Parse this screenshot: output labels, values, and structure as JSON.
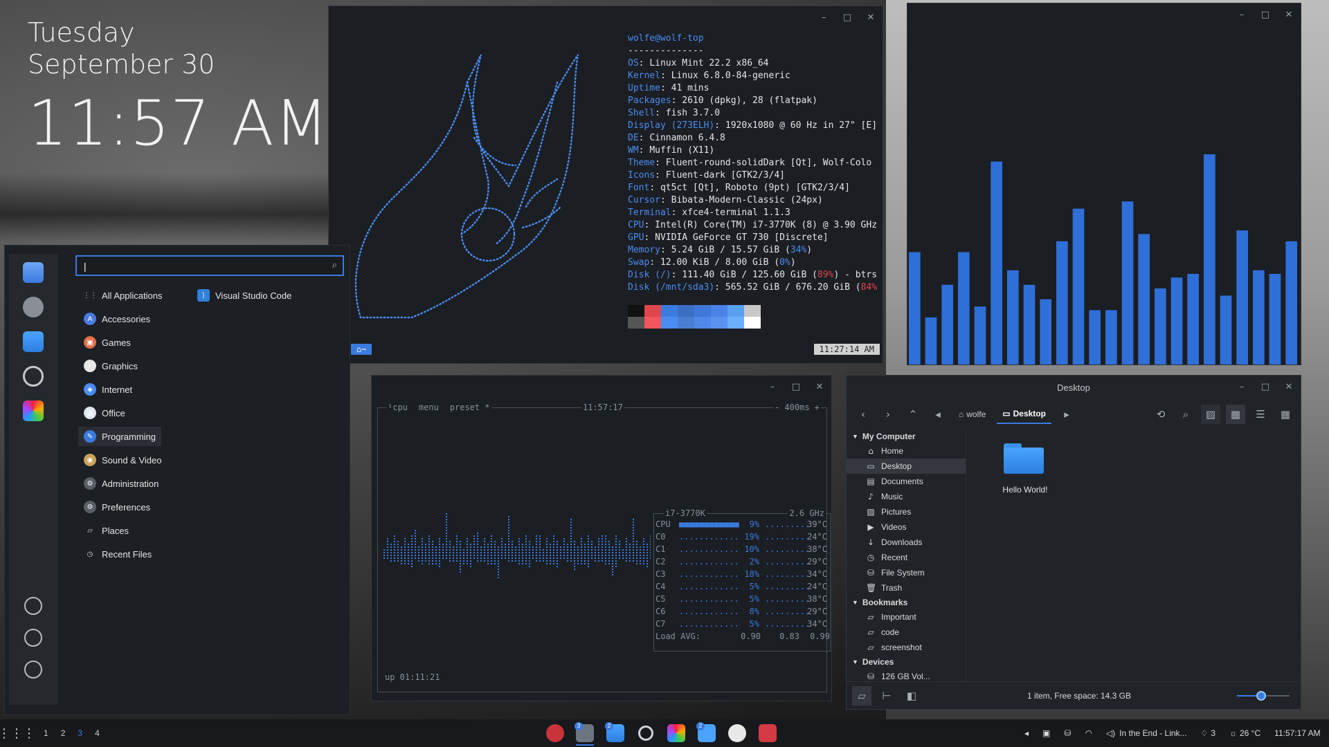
{
  "desklet": {
    "day": "Tuesday",
    "date": "September 30",
    "time": "11:57 AM"
  },
  "neofetch": {
    "user_host": "wolfe@wolf-top",
    "separator": "--------------",
    "lines": [
      {
        "k": "OS",
        "v": "Linux Mint 22.2 x86_64"
      },
      {
        "k": "Kernel",
        "v": "Linux 6.8.0-84-generic"
      },
      {
        "k": "Uptime",
        "v": "41 mins"
      },
      {
        "k": "Packages",
        "v": "2610 (dpkg), 28 (flatpak)"
      },
      {
        "k": "Shell",
        "v": "fish 3.7.0"
      },
      {
        "k": "Display (273ELH)",
        "v": "1920x1080 @ 60 Hz in 27\" [E]"
      },
      {
        "k": "DE",
        "v": "Cinnamon 6.4.8"
      },
      {
        "k": "WM",
        "v": "Muffin (X11)"
      },
      {
        "k": "Theme",
        "v": "Fluent-round-solidDark [Qt], Wolf-Colo"
      },
      {
        "k": "Icons",
        "v": "Fluent-dark [GTK2/3/4]"
      },
      {
        "k": "Font",
        "v": "qt5ct [Qt], Roboto (9pt) [GTK2/3/4]"
      },
      {
        "k": "Cursor",
        "v": "Bibata-Modern-Classic (24px)"
      },
      {
        "k": "Terminal",
        "v": "xfce4-terminal 1.1.3"
      },
      {
        "k": "CPU",
        "v": "Intel(R) Core(TM) i7-3770K (8) @ 3.90 GHz"
      },
      {
        "k": "GPU",
        "v": "NVIDIA GeForce GT 730 [Discrete]"
      },
      {
        "k": "Memory",
        "v": "5.24 GiB / 15.57 GiB (",
        "p": "34%",
        "tail": ")",
        "hi": false
      },
      {
        "k": "Swap",
        "v": "12.00 KiB / 8.00 GiB (",
        "p": "0%",
        "tail": ")",
        "hi": false
      },
      {
        "k": "Disk (/)",
        "v": "111.40 GiB / 125.60 GiB (",
        "p": "89%",
        "tail": ") - btrs",
        "hi": true
      },
      {
        "k": "Disk (/mnt/sda3)",
        "v": "565.52 GiB / 676.20 GiB (",
        "p": "84%",
        "tail": "",
        "hi": true
      }
    ],
    "palette_top": [
      "#111111",
      "#e0474c",
      "#3a7be0",
      "#3a6fc4",
      "#3f78d8",
      "#4a82e6",
      "#5aa0f0",
      "#c8c8c8"
    ],
    "palette_bottom": [
      "#555555",
      "#f0565b",
      "#4a8cf0",
      "#4a7ed4",
      "#5088e8",
      "#5a92f0",
      "#6ab0ff",
      "#ffffff"
    ],
    "prompt_left": "⌂~",
    "prompt_right": "11:27:14 AM"
  },
  "cava": {
    "values": [
      0.31,
      0.13,
      0.22,
      0.31,
      0.16,
      0.56,
      0.26,
      0.22,
      0.18,
      0.34,
      0.43,
      0.15,
      0.15,
      0.45,
      0.36,
      0.21,
      0.24,
      0.25,
      0.58,
      0.19,
      0.37,
      0.26,
      0.25,
      0.34
    ],
    "color": "#2f6fd8"
  },
  "btop": {
    "header": {
      "tab1": "¹cpu",
      "tab2": "menu",
      "tab3": "preset *",
      "time": "11:57:17",
      "rate": "- 400ms +"
    },
    "cpu_model": "i7-3770K",
    "freq": "2.6 GHz",
    "rows": [
      {
        "name": "CPU",
        "pct": "9%",
        "temp": "39°C"
      },
      {
        "name": "C0",
        "pct": "19%",
        "temp": "24°C"
      },
      {
        "name": "C1",
        "pct": "10%",
        "temp": "38°C"
      },
      {
        "name": "C2",
        "pct": "2%",
        "temp": "29°C"
      },
      {
        "name": "C3",
        "pct": "18%",
        "temp": "34°C"
      },
      {
        "name": "C4",
        "pct": "5%",
        "temp": "24°C"
      },
      {
        "name": "C5",
        "pct": "5%",
        "temp": "38°C"
      },
      {
        "name": "C6",
        "pct": "8%",
        "temp": "29°C"
      },
      {
        "name": "C7",
        "pct": "5%",
        "temp": "34°C"
      }
    ],
    "load_label": "Load AVG:",
    "load": [
      "0.90",
      "0.83",
      "0.99"
    ],
    "uptime": "up 01:11:21"
  },
  "files": {
    "title": "Desktop",
    "crumbs": [
      "wolfe",
      "Desktop"
    ],
    "sections": [
      {
        "head": "My Computer",
        "items": [
          {
            "icon": "⌂",
            "label": "Home",
            "icon_name": "home-icon"
          },
          {
            "icon": "▭",
            "label": "Desktop",
            "icon_name": "desktop-icon",
            "sel": true
          },
          {
            "icon": "▤",
            "label": "Documents",
            "icon_name": "documents-icon"
          },
          {
            "icon": "♪",
            "label": "Music",
            "icon_name": "music-icon"
          },
          {
            "icon": "▨",
            "label": "Pictures",
            "icon_name": "pictures-icon"
          },
          {
            "icon": "▶",
            "label": "Videos",
            "icon_name": "videos-icon"
          },
          {
            "icon": "↓",
            "label": "Downloads",
            "icon_name": "downloads-icon"
          },
          {
            "icon": "◷",
            "label": "Recent",
            "icon_name": "recent-icon"
          },
          {
            "icon": "⛁",
            "label": "File System",
            "icon_name": "filesystem-icon"
          },
          {
            "icon": "🗑",
            "label": "Trash",
            "icon_name": "trash-icon"
          }
        ]
      },
      {
        "head": "Bookmarks",
        "items": [
          {
            "icon": "▱",
            "label": "Important",
            "icon_name": "folder-icon"
          },
          {
            "icon": "▱",
            "label": "code",
            "icon_name": "folder-icon"
          },
          {
            "icon": "▱",
            "label": "screenshot",
            "icon_name": "folder-icon"
          }
        ]
      },
      {
        "head": "Devices",
        "items": [
          {
            "icon": "⛁",
            "label": "126 GB Vol...",
            "icon_name": "drive-icon"
          }
        ]
      }
    ],
    "item": "Hello World!",
    "status": "1 item, Free space: 14.3 GB"
  },
  "menu": {
    "categories": [
      {
        "label": "All Applications",
        "icon": "⋮⋮",
        "color": "transparent",
        "name": "all-applications"
      },
      {
        "label": "Accessories",
        "icon": "A",
        "color": "#4a7be0",
        "name": "accessories"
      },
      {
        "label": "Games",
        "icon": "▣",
        "color": "#e0704a",
        "name": "games"
      },
      {
        "label": "Graphics",
        "icon": "◐",
        "color": "#e8e8e8",
        "name": "graphics"
      },
      {
        "label": "Internet",
        "icon": "◈",
        "color": "#4a8cf0",
        "name": "internet"
      },
      {
        "label": "Office",
        "icon": "▤",
        "color": "#dfe6f2",
        "name": "office"
      },
      {
        "label": "Programming",
        "icon": "✎",
        "color": "#3a7be0",
        "name": "programming",
        "hover": true
      },
      {
        "label": "Sound & Video",
        "icon": "◉",
        "color": "#c9a25a",
        "name": "sound-video"
      },
      {
        "label": "Administration",
        "icon": "⚙",
        "color": "#5a5f66",
        "name": "administration"
      },
      {
        "label": "Preferences",
        "icon": "⚙",
        "color": "#5a5f66",
        "name": "preferences"
      },
      {
        "label": "Places",
        "icon": "▱",
        "color": "transparent",
        "name": "places"
      },
      {
        "label": "Recent Files",
        "icon": "◷",
        "color": "transparent",
        "name": "recent-files"
      }
    ],
    "app": "Visual Studio Code"
  },
  "panel": {
    "workspaces": [
      "1",
      "2",
      "3",
      "4"
    ],
    "active_ws": "3",
    "tray": {
      "music": "In the End - Link...",
      "notif_count": "3",
      "weather": "26 °C",
      "clock": "11:57:17 AM"
    },
    "badges": {
      "terminal": "3",
      "files": "2",
      "editor": "2"
    }
  }
}
